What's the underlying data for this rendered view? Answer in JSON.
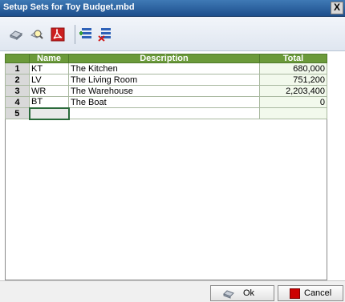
{
  "window": {
    "title": "Setup Sets for Toy Budget.mbd",
    "close_glyph": "X"
  },
  "toolbar": {
    "buttons": [
      {
        "icon": "print-icon"
      },
      {
        "icon": "print-preview-icon"
      },
      {
        "icon": "pdf-icon"
      },
      {
        "icon": "insert-row-icon"
      },
      {
        "icon": "delete-row-icon"
      }
    ]
  },
  "grid": {
    "columns": [
      "Name",
      "Description",
      "Total"
    ],
    "rows": [
      {
        "num": "1",
        "name": "KT",
        "description": "The Kitchen",
        "total": "680,000"
      },
      {
        "num": "2",
        "name": "LV",
        "description": "The Living Room",
        "total": "751,200"
      },
      {
        "num": "3",
        "name": "WR",
        "description": "The Warehouse",
        "total": "2,203,400"
      },
      {
        "num": "4",
        "name": "BT",
        "description": "The Boat",
        "total": "0"
      },
      {
        "num": "5",
        "name": "",
        "description": "",
        "total": ""
      }
    ],
    "colors": {
      "header": "#6b9a3a",
      "total_column": "#f2f9ec"
    }
  },
  "footer": {
    "ok_label": "Ok",
    "cancel_label": "Cancel",
    "cancel_color": "#cc0000"
  }
}
